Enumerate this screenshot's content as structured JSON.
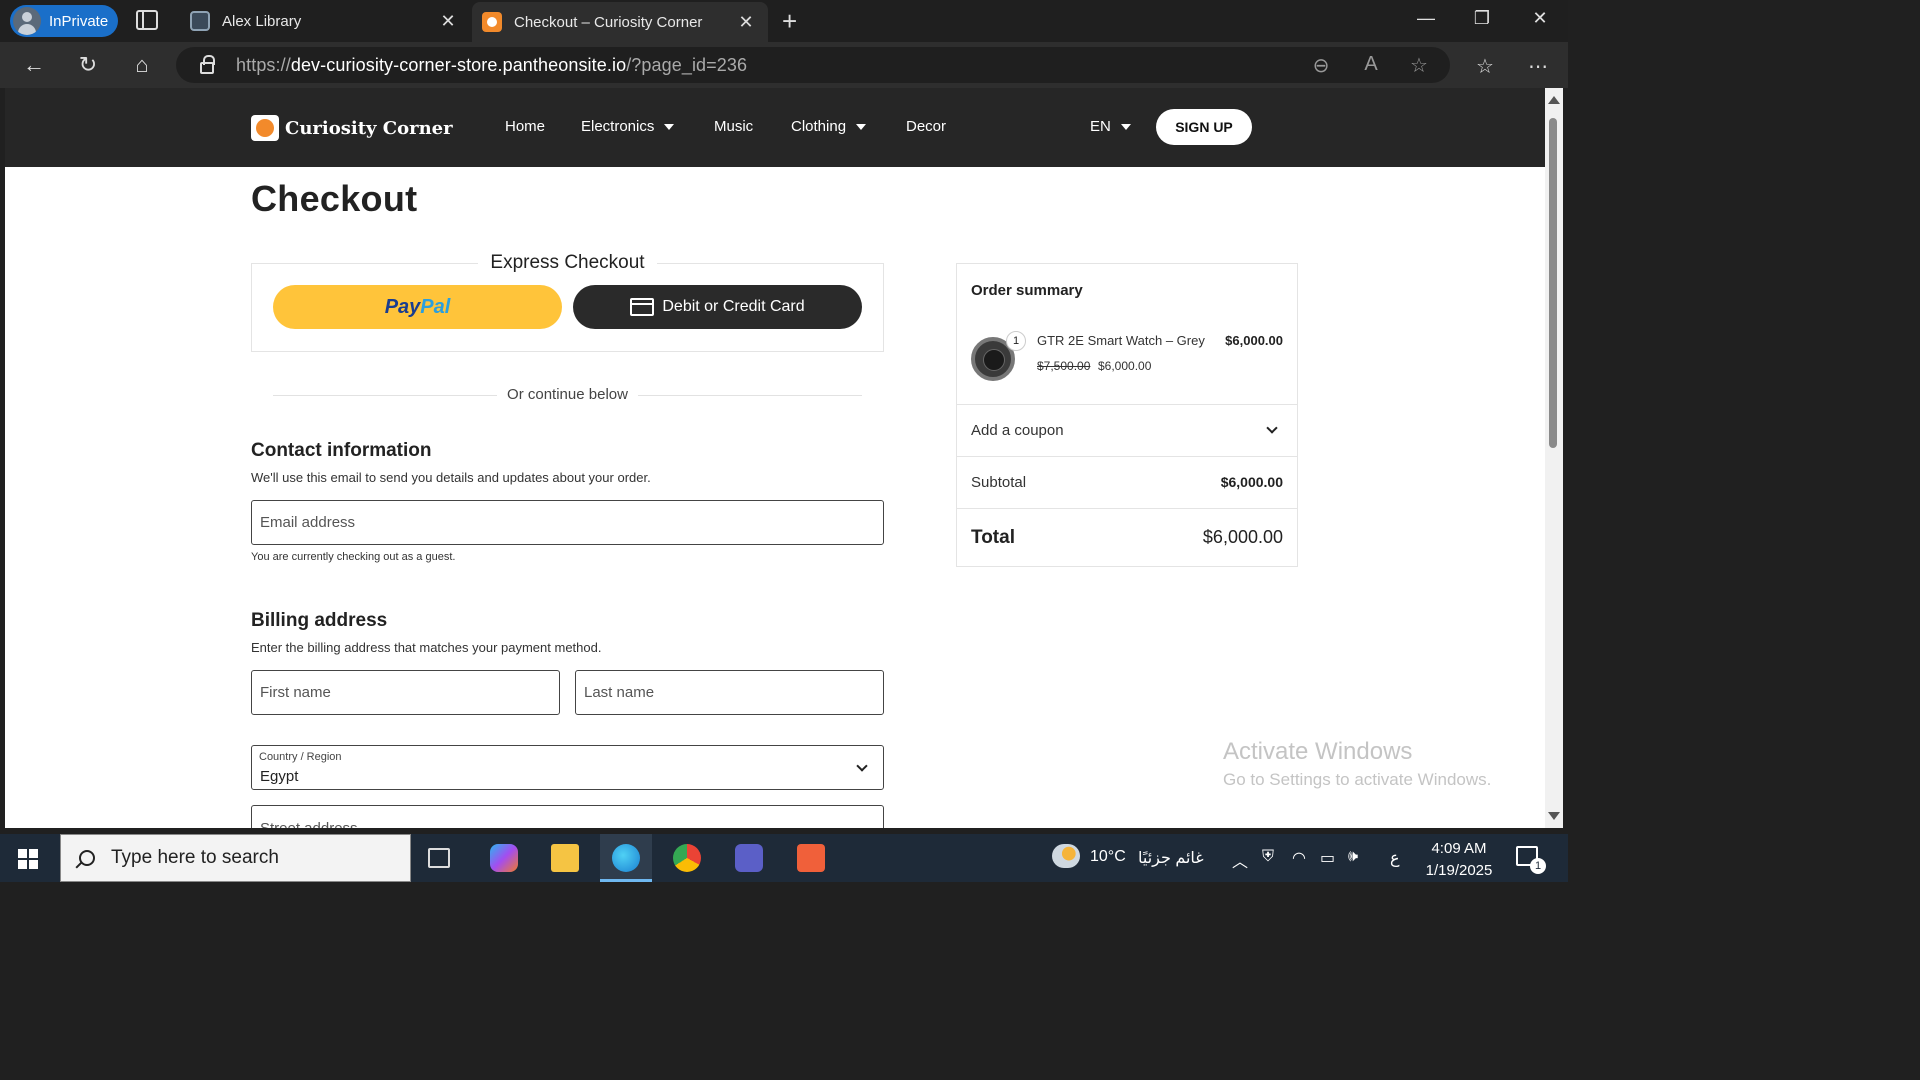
{
  "browser": {
    "inprivate_label": "InPrivate",
    "tabs": [
      {
        "title": "Alex Library"
      },
      {
        "title": "Checkout – Curiosity Corner"
      }
    ],
    "url_prefix": "https://",
    "url_host": "dev-curiosity-corner-store.pantheonsite.io",
    "url_path": "/?page_id=236"
  },
  "site": {
    "brand": "Curiosity Corner",
    "nav": [
      {
        "label": "Home"
      },
      {
        "label": "Electronics"
      },
      {
        "label": "Music"
      },
      {
        "label": "Clothing"
      },
      {
        "label": "Decor"
      }
    ],
    "language": "EN",
    "signup": "SIGN UP"
  },
  "checkout": {
    "title": "Checkout",
    "express_title": "Express Checkout",
    "paypal_pay": "Pay",
    "paypal_pal": "Pal",
    "card_button": "Debit or Credit Card",
    "divider": "Or continue below",
    "contact_title": "Contact information",
    "contact_desc": "We'll use this email to send you details and updates about your order.",
    "email_placeholder": "Email address",
    "guest_note": "You are currently checking out as a guest.",
    "billing_title": "Billing address",
    "billing_desc": "Enter the billing address that matches your payment method.",
    "first_name_placeholder": "First name",
    "last_name_placeholder": "Last name",
    "country_label": "Country / Region",
    "country_value": "Egypt",
    "street_placeholder": "Street address"
  },
  "summary": {
    "title": "Order summary",
    "item": {
      "name": "GTR 2E Smart Watch – Grey",
      "quantity": "1",
      "price": "$6,000.00",
      "old_price": "$7,500.00",
      "sale_price": "$6,000.00"
    },
    "coupon": "Add a coupon",
    "subtotal_label": "Subtotal",
    "subtotal_value": "$6,000.00",
    "total_label": "Total",
    "total_value": "$6,000.00"
  },
  "watermark": {
    "line1": "Activate Windows",
    "line2": "Go to Settings to activate Windows."
  },
  "taskbar": {
    "search_placeholder": "Type here to search",
    "weather": "10°C",
    "weather_text": "غائم جزئيًا",
    "lang": "ع",
    "time": "4:09 AM",
    "date": "1/19/2025",
    "notification_count": "1"
  },
  "colors": {
    "header_bg": "#262626",
    "paypal_yellow": "#ffc43a",
    "edge_accent": "#1a6fc9"
  }
}
